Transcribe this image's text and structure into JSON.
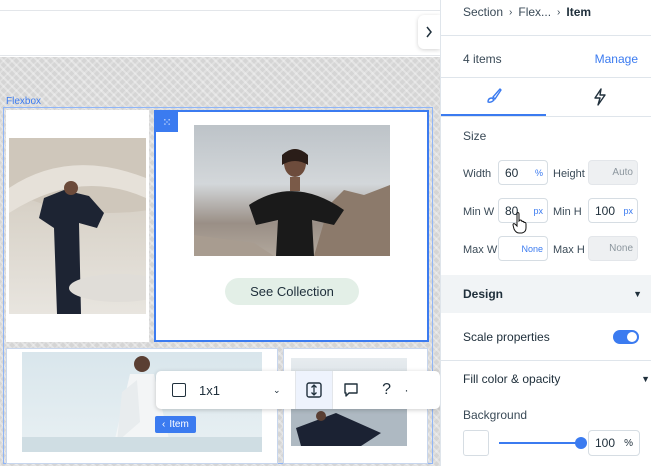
{
  "canvas": {
    "flexbox_label": "Flexbox",
    "see_collection_label": "See Collection",
    "item_tag_label": "Item",
    "toolbar": {
      "ratio_label": "1x1"
    }
  },
  "panel": {
    "breadcrumb": [
      "Section",
      "Flex...",
      "Item"
    ],
    "items_count": "4 items",
    "manage_label": "Manage",
    "size": {
      "title": "Size",
      "width_label": "Width",
      "width_value": "60",
      "width_unit": "%",
      "height_label": "Height",
      "height_value": "Auto",
      "min_w_label": "Min W",
      "min_w_value": "80",
      "min_w_unit": "px",
      "min_h_label": "Min H",
      "min_h_value": "100",
      "min_h_unit": "px",
      "max_w_label": "Max W",
      "max_w_value": "None",
      "max_h_label": "Max H",
      "max_h_value": "None"
    },
    "design": {
      "title": "Design",
      "scale_label": "Scale properties",
      "scale_enabled": true,
      "fill_label": "Fill color & opacity",
      "background_label": "Background",
      "opacity_value": "100",
      "opacity_unit": "%",
      "opacity_fraction": 1.0
    }
  },
  "colors": {
    "accent": "#3b7bf0",
    "button_bg": "#e3efe7"
  }
}
